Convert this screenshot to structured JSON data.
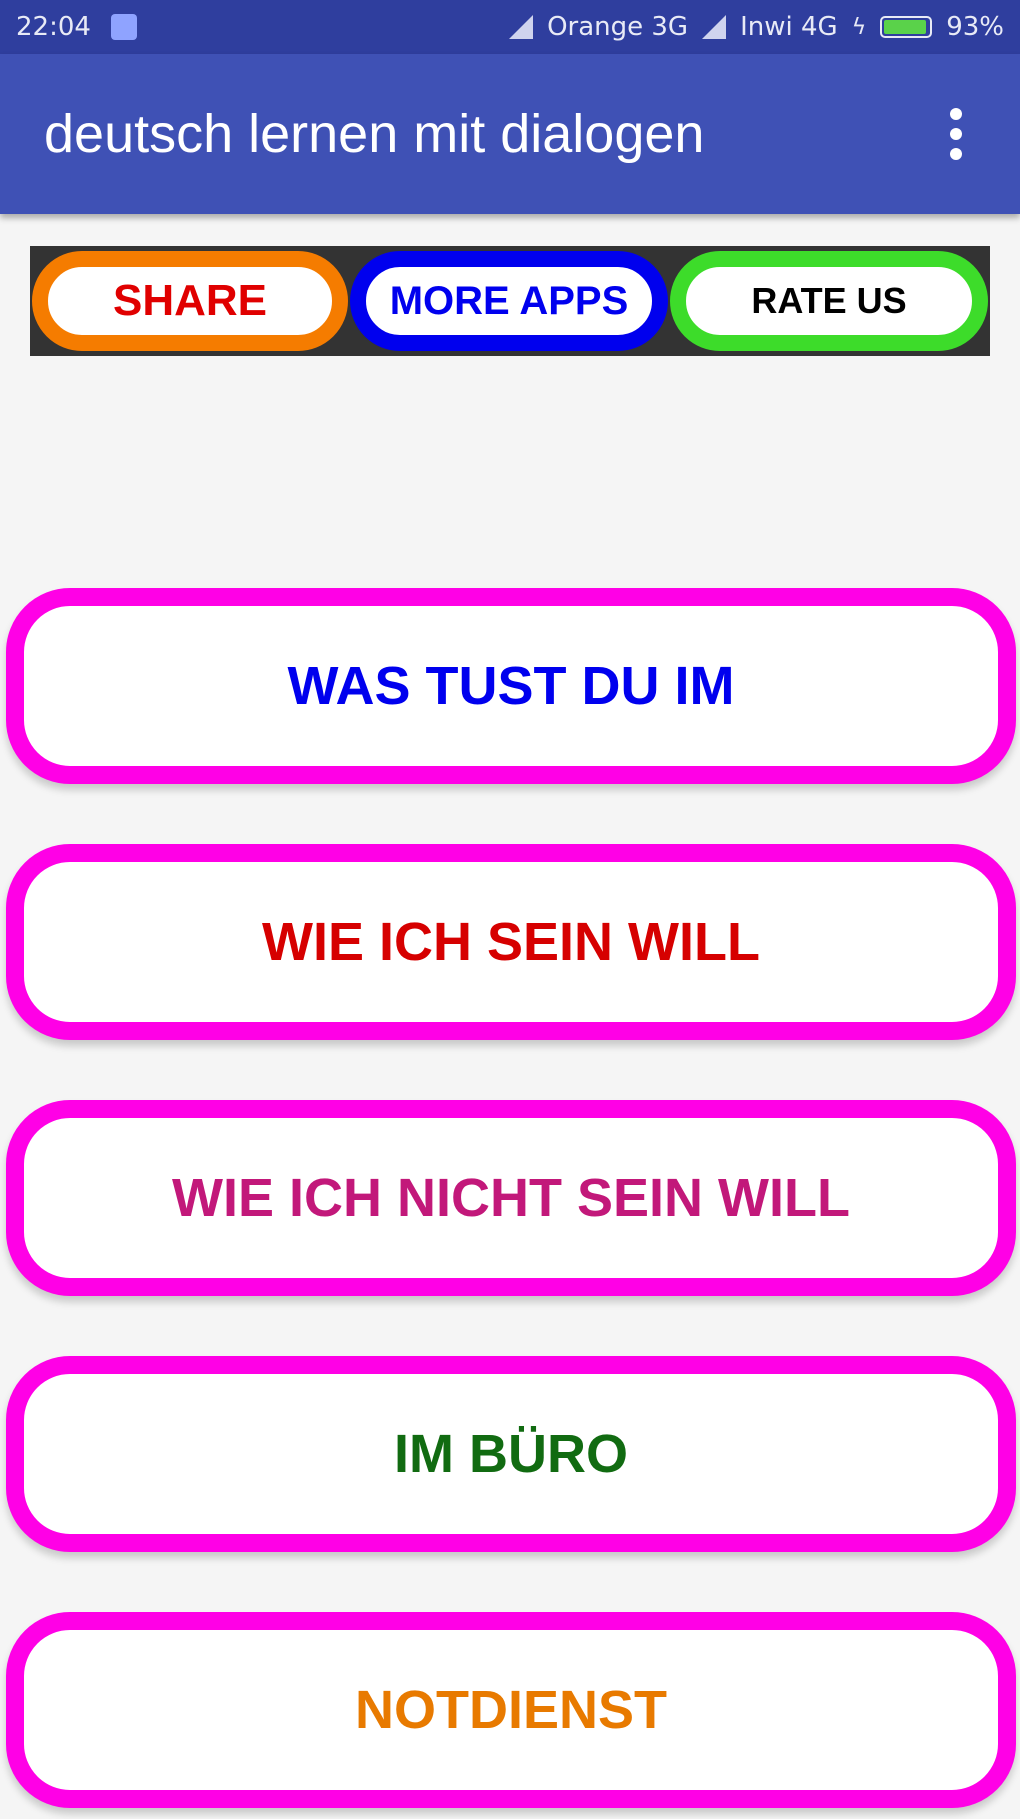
{
  "status_bar": {
    "time": "22:04",
    "carrier1": "Orange 3G",
    "carrier2": "Inwi 4G",
    "battery": "93%"
  },
  "app_bar": {
    "title": "deutsch lernen mit dialogen",
    "menu_icon": "more-vert-icon"
  },
  "actions": {
    "share": "SHARE",
    "more_apps": "MORE APPS",
    "rate_us": "RATE US"
  },
  "menu": {
    "items": [
      {
        "label": "WAS TUST DU IM",
        "color": "#0000ee"
      },
      {
        "label": "WIE ICH SEIN WILL",
        "color": "#d60000"
      },
      {
        "label": "WIE ICH NICHT SEIN WILL",
        "color": "#c2187a"
      },
      {
        "label": "IM BÜRO",
        "color": "#116b11"
      },
      {
        "label": "NOTDIENST",
        "color": "#e87a00"
      }
    ],
    "border_color": "#ff00e6"
  },
  "colors": {
    "status_bar": "#2f3e9e",
    "app_bar": "#3f51b5",
    "share_border": "#f57c00",
    "more_apps_border": "#0000ee",
    "rate_us_border": "#3ddc2a"
  }
}
